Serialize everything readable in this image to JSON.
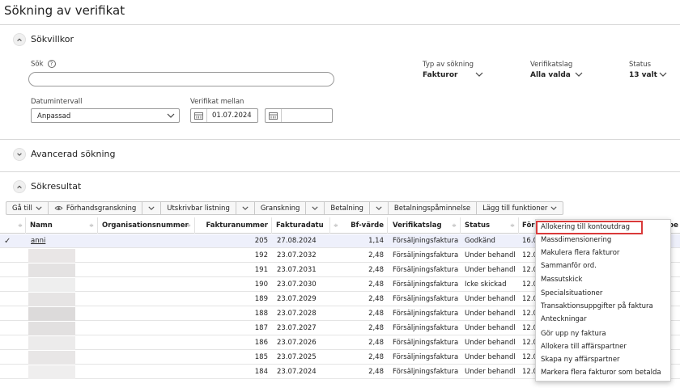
{
  "page": {
    "title": "Sökning av verifikat"
  },
  "sections": {
    "sokvillkor": "Sökvillkor",
    "avancerad": "Avancerad sökning",
    "sokresultat": "Sökresultat"
  },
  "search": {
    "label": "Sök",
    "help": "?",
    "value": "",
    "placeholder": ""
  },
  "filters": {
    "typ_label": "Typ av sökning",
    "typ_value": "Fakturor",
    "verifikatslag_label": "Verifikatslag",
    "verifikatslag_value": "Alla valda",
    "status_label": "Status",
    "status_value": "13 valt",
    "datumintervall_label": "Datumintervall",
    "datumintervall_value": "Anpassad",
    "verifikat_mellan_label": "Verifikat mellan",
    "date_from": "01.07.2024",
    "date_to": ""
  },
  "toolbar": {
    "ga_till": "Gå till",
    "forhandsgranskning": "Förhandsgranskning",
    "utskrivbar": "Utskrivbar listning",
    "granskning": "Granskning",
    "betalning": "Betalning",
    "betalningspaminnelse": "Betalningspåminnelse",
    "lagg_till": "Lägg till funktioner"
  },
  "table": {
    "columns": [
      "Namn",
      "Organisationsnummer",
      "Fakturanummer",
      "Fakturadatum",
      "Bf-värde",
      "Verifikatslag",
      "Status",
      "För"
    ],
    "col_display": {
      "namn": "Namn",
      "org": "Organisationsnummer",
      "fnr": "Fakturanummer",
      "fdat": "Fakturadatu",
      "bf": "Bf-värde",
      "vslag": "Verifikatslag",
      "status": "Status",
      "for": "För",
      "be": "be"
    },
    "sort_glyph": "≑",
    "check_glyph": "✓",
    "rows": [
      {
        "namn": "anni",
        "fnr": "205",
        "fdat": "27.08.2024",
        "bf": "1,14",
        "vslag": "Försäljningsfaktura",
        "status": "Godkänd",
        "for": "16.0",
        "selected": true
      },
      {
        "namn": "",
        "fnr": "192",
        "fdat": "23.07.2032",
        "bf": "2,48",
        "vslag": "Försäljningsfaktura",
        "status": "Under behandl",
        "for": "12.0"
      },
      {
        "namn": "",
        "fnr": "191",
        "fdat": "23.07.2031",
        "bf": "2,48",
        "vslag": "Försäljningsfaktura",
        "status": "Under behandl",
        "for": "12.0"
      },
      {
        "namn": "",
        "fnr": "190",
        "fdat": "23.07.2030",
        "bf": "2,48",
        "vslag": "Försäljningsfaktura",
        "status": "Icke skickad",
        "for": "12.0"
      },
      {
        "namn": "",
        "fnr": "189",
        "fdat": "23.07.2029",
        "bf": "2,48",
        "vslag": "Försäljningsfaktura",
        "status": "Under behandl",
        "for": "12.0"
      },
      {
        "namn": "",
        "fnr": "188",
        "fdat": "23.07.2028",
        "bf": "2,48",
        "vslag": "Försäljningsfaktura",
        "status": "Under behandl",
        "for": "12.0"
      },
      {
        "namn": "",
        "fnr": "187",
        "fdat": "23.07.2027",
        "bf": "2,48",
        "vslag": "Försäljningsfaktura",
        "status": "Under behandl",
        "for": "12.0"
      },
      {
        "namn": "",
        "fnr": "186",
        "fdat": "23.07.2026",
        "bf": "2,48",
        "vslag": "Försäljningsfaktura",
        "status": "Under behandl",
        "for": "12.0"
      },
      {
        "namn": "",
        "fnr": "185",
        "fdat": "23.07.2025",
        "bf": "2,48",
        "vslag": "Försäljningsfaktura",
        "status": "Under behandl",
        "for": "12.0"
      },
      {
        "namn": "",
        "fnr": "184",
        "fdat": "23.07.2024",
        "bf": "2,48",
        "vslag": "Försäljningsfaktura",
        "status": "Under behandl",
        "for": "12.0"
      }
    ]
  },
  "menu": {
    "items": [
      "Allokering till kontoutdrag",
      "Massdimensionering",
      "Makulera flera fakturor",
      "Sammanför ord.",
      "Massutskick",
      "Specialsituationer",
      "Transaktionsuppgifter på faktura",
      "Anteckningar",
      "Gör upp ny faktura",
      "Allokera till affärspartner",
      "Skapa ny affärspartner",
      "Markera flera fakturor som betalda"
    ],
    "highlighted_index": 0
  },
  "colors": {
    "highlight_border": "#d93a3a",
    "selected_row": "#eef0fb"
  }
}
